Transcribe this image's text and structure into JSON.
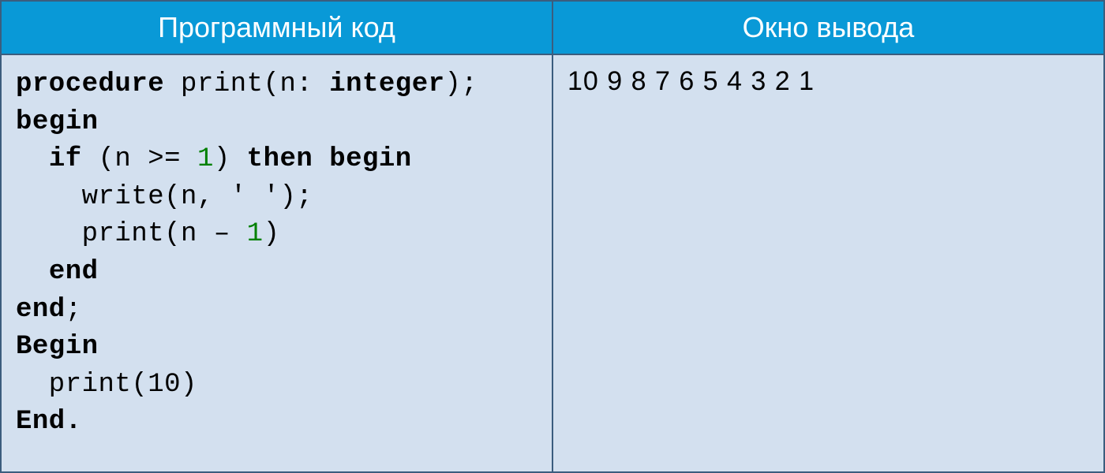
{
  "header": {
    "left": "Программный код",
    "right": "Окно вывода"
  },
  "code": {
    "tokens": [
      {
        "t": "procedure",
        "c": "kw"
      },
      {
        "t": " print(n: ",
        "c": ""
      },
      {
        "t": "integer",
        "c": "kw"
      },
      {
        "t": ");\n",
        "c": ""
      },
      {
        "t": "begin",
        "c": "kw"
      },
      {
        "t": "\n",
        "c": ""
      },
      {
        "t": "  ",
        "c": ""
      },
      {
        "t": "if",
        "c": "kw"
      },
      {
        "t": " (n >= ",
        "c": ""
      },
      {
        "t": "1",
        "c": "num"
      },
      {
        "t": ") ",
        "c": ""
      },
      {
        "t": "then begin",
        "c": "kw"
      },
      {
        "t": "\n",
        "c": ""
      },
      {
        "t": "    write(n, ' ');\n",
        "c": ""
      },
      {
        "t": "    print(n – ",
        "c": ""
      },
      {
        "t": "1",
        "c": "num"
      },
      {
        "t": ")\n",
        "c": ""
      },
      {
        "t": "  ",
        "c": ""
      },
      {
        "t": "end",
        "c": "kw"
      },
      {
        "t": "\n",
        "c": ""
      },
      {
        "t": "end",
        "c": "kw"
      },
      {
        "t": ";\n",
        "c": ""
      },
      {
        "t": "Begin",
        "c": "kw"
      },
      {
        "t": "\n",
        "c": ""
      },
      {
        "t": "  print(10)\n",
        "c": ""
      },
      {
        "t": "End.",
        "c": "kw"
      }
    ]
  },
  "output": "10 9 8 7 6 5 4 3 2 1"
}
